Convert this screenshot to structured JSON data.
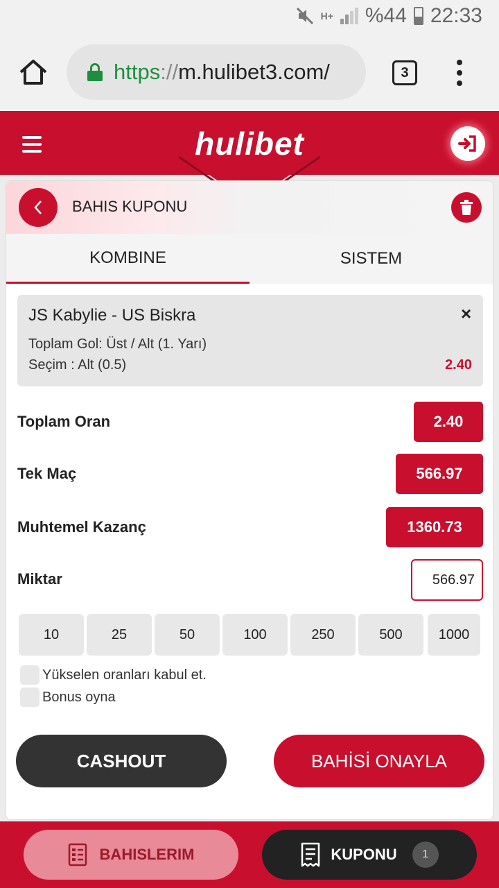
{
  "status_bar": {
    "hplus": "H+",
    "battery": "%44",
    "time": "22:33"
  },
  "browser": {
    "url_scheme": "https",
    "url_sep": "://",
    "url_host": "m.hulibet3.com/",
    "tab_count": "3"
  },
  "header": {
    "logo": "hulibet"
  },
  "slip": {
    "title": "BAHIS KUPONU",
    "tabs": [
      {
        "label": "KOMBINE"
      },
      {
        "label": "SISTEM"
      }
    ],
    "match": {
      "name": "JS Kabylie - US Biskra",
      "market": "Toplam Gol: Üst / Alt (1. Yarı)",
      "selection": "Seçim : Alt (0.5)",
      "odds": "2.40",
      "close": "×"
    },
    "summary": {
      "total_odds_label": "Toplam Oran",
      "total_odds_value": "2.40",
      "single_label": "Tek Maç",
      "single_value": "566.97",
      "winnings_label": "Muhtemel Kazanç",
      "winnings_value": "1360.73",
      "amount_label": "Miktar",
      "amount_value": "566.97"
    },
    "quick_amounts": [
      "10",
      "25",
      "50",
      "100",
      "250",
      "500",
      "1000"
    ],
    "options": {
      "accept_odds": "Yükselen oranları kabul et.",
      "bonus": "Bonus oyna"
    },
    "cashout_label": "CASHOUT",
    "confirm_label": "BAHİSİ ONAYLA"
  },
  "bottom": {
    "bets_label": "BAHISLERIM",
    "coupon_label": "KUPONU",
    "coupon_count": "1"
  },
  "colors": {
    "brand": "#c8102e",
    "dark": "#333333",
    "url_green": "#1e8e3e"
  }
}
